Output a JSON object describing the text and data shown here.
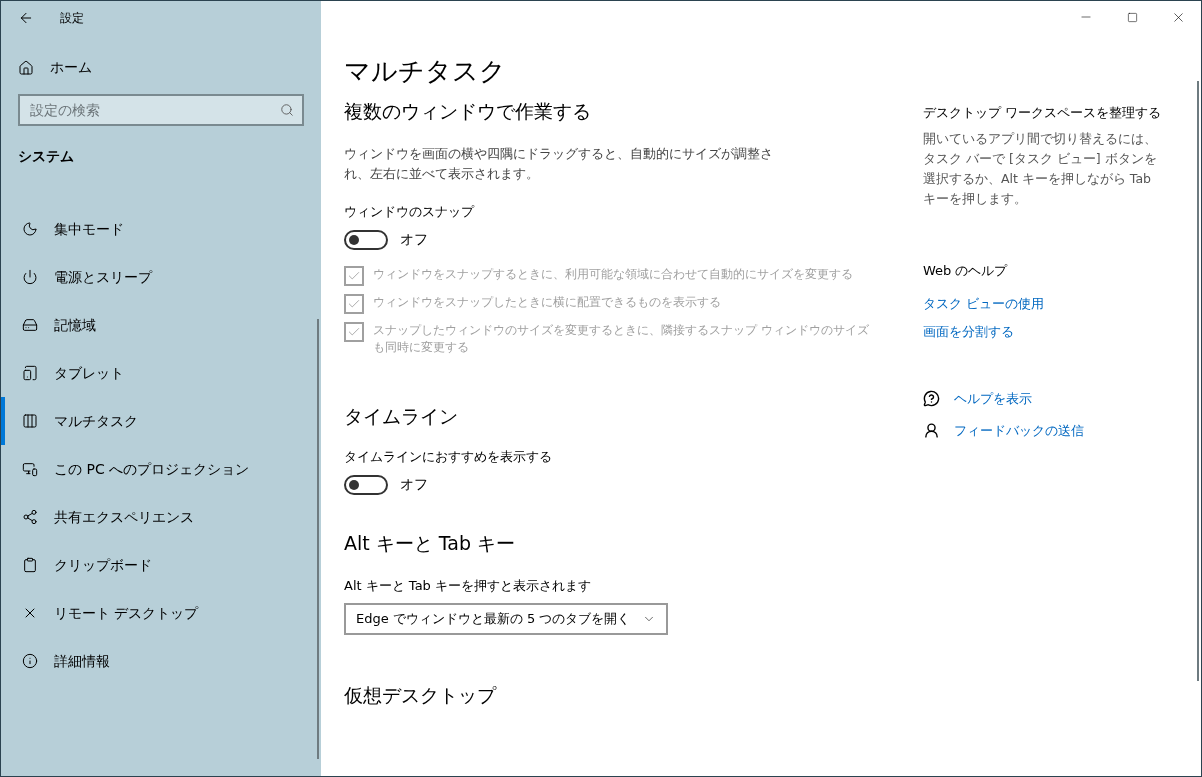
{
  "window": {
    "title": "設定"
  },
  "sidebar": {
    "home": "ホーム",
    "search": {
      "placeholder": "設定の検索"
    },
    "section": "システム",
    "items": [
      {
        "label": "集中モード",
        "selected": false
      },
      {
        "label": "電源とスリープ",
        "selected": false
      },
      {
        "label": "記憶域",
        "selected": false
      },
      {
        "label": "タブレット",
        "selected": false
      },
      {
        "label": "マルチタスク",
        "selected": true
      },
      {
        "label": "この PC へのプロジェクション",
        "selected": false
      },
      {
        "label": "共有エクスペリエンス",
        "selected": false
      },
      {
        "label": "クリップボード",
        "selected": false
      },
      {
        "label": "リモート デスクトップ",
        "selected": false
      },
      {
        "label": "詳細情報",
        "selected": false
      }
    ]
  },
  "page_title": "マルチタスク",
  "snap": {
    "heading": "複数のウィンドウで作業する",
    "description": "ウィンドウを画面の横や四隅にドラッグすると、自動的にサイズが調整され、左右に並べて表示されます。",
    "toggle_label": "ウィンドウのスナップ",
    "toggle": {
      "on": false,
      "state_text": "オフ"
    },
    "options": [
      {
        "label": "ウィンドウをスナップするときに、利用可能な領域に合わせて自動的にサイズを変更する",
        "checked": true,
        "disabled": true
      },
      {
        "label": "ウィンドウをスナップしたときに横に配置できるものを表示する",
        "checked": true,
        "disabled": true
      },
      {
        "label": "スナップしたウィンドウのサイズを変更するときに、隣接するスナップ ウィンドウのサイズも同時に変更する",
        "checked": true,
        "disabled": true
      }
    ]
  },
  "timeline": {
    "heading": "タイムライン",
    "toggle_label": "タイムラインにおすすめを表示する",
    "toggle": {
      "on": false,
      "state_text": "オフ"
    }
  },
  "alt_tab": {
    "heading": "Alt キーと Tab キー",
    "label": "Alt キーと Tab キーを押すと表示されます",
    "dropdown": "Edge でウィンドウと最新の 5 つのタブを開く"
  },
  "virtual_desktops": {
    "heading": "仮想デスクトップ"
  },
  "aside": {
    "heading": "デスクトップ ワークスペースを整理する",
    "text": "開いているアプリ間で切り替えるには、タスク バーで [タスク ビュー] ボタンを選択するか、Alt キーを押しながら Tab キーを押します。",
    "help_heading": "Web のヘルプ",
    "links": [
      "タスク ビューの使用",
      "画面を分割する"
    ],
    "help": "ヘルプを表示",
    "feedback": "フィードバックの送信"
  }
}
